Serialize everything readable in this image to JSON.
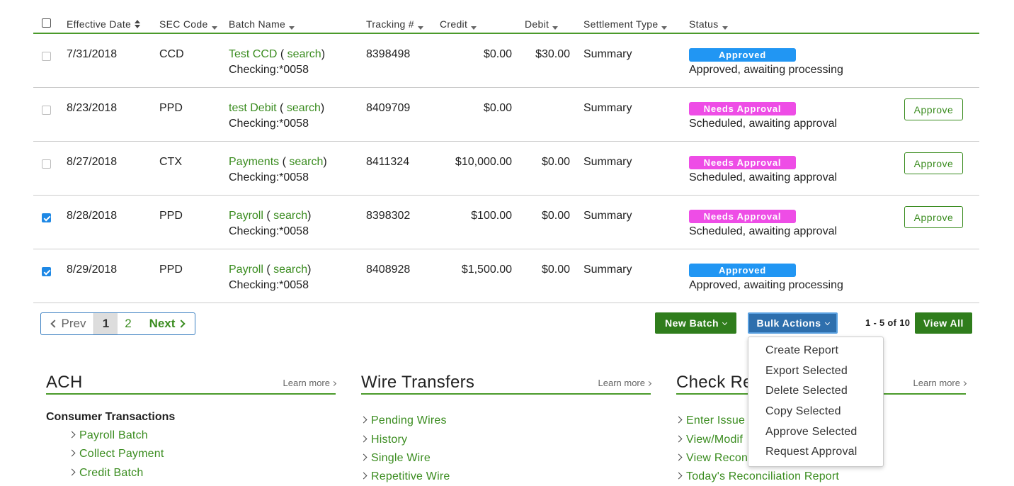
{
  "table": {
    "headers": {
      "effective_date": "Effective Date",
      "sec_code": "SEC Code",
      "batch_name": "Batch Name",
      "tracking": "Tracking #",
      "credit": "Credit",
      "debit": "Debit",
      "settlement_type": "Settlement Type",
      "status": "Status"
    },
    "rows": [
      {
        "checked": false,
        "date": "7/31/2018",
        "sec": "CCD",
        "name": "Test CCD",
        "search_open": " ( ",
        "search": "search",
        "search_close": ")",
        "account": "Checking:*0058",
        "tracking": "8398498",
        "credit": "$0.00",
        "debit": "$30.00",
        "settlement": "Summary",
        "badge": "Approved",
        "status": "Approved, awaiting processing",
        "action": ""
      },
      {
        "checked": false,
        "date": "8/23/2018",
        "sec": "PPD",
        "name": "test Debit",
        "search_open": " ( ",
        "search": "search",
        "search_close": ")",
        "account": "Checking:*0058",
        "tracking": "8409709",
        "credit": "$0.00",
        "debit": "",
        "settlement": "Summary",
        "badge": "Needs Approval",
        "status": "Scheduled, awaiting approval",
        "action": "Approve"
      },
      {
        "checked": false,
        "date": "8/27/2018",
        "sec": "CTX",
        "name": "Payments",
        "search_open": " ( ",
        "search": "search",
        "search_close": ")",
        "account": "Checking:*0058",
        "tracking": "8411324",
        "credit": "$10,000.00",
        "debit": "$0.00",
        "settlement": "Summary",
        "badge": "Needs Approval",
        "status": "Scheduled, awaiting approval",
        "action": "Approve"
      },
      {
        "checked": true,
        "date": "8/28/2018",
        "sec": "PPD",
        "name": "Payroll",
        "search_open": " ( ",
        "search": "search",
        "search_close": ")",
        "account": "Checking:*0058",
        "tracking": "8398302",
        "credit": "$100.00",
        "debit": "$0.00",
        "settlement": "Summary",
        "badge": "Needs Approval",
        "status": "Scheduled, awaiting approval",
        "action": "Approve"
      },
      {
        "checked": true,
        "date": "8/29/2018",
        "sec": "PPD",
        "name": "Payroll",
        "search_open": " ( ",
        "search": "search",
        "search_close": ")",
        "account": "Checking:*0058",
        "tracking": "8408928",
        "credit": "$1,500.00",
        "debit": "$0.00",
        "settlement": "Summary",
        "badge": "Approved",
        "status": "Approved, awaiting processing",
        "action": ""
      }
    ]
  },
  "pagination": {
    "prev": "Prev",
    "page1": "1",
    "page2": "2",
    "next": "Next"
  },
  "toolbar": {
    "new_batch": "New Batch",
    "bulk_actions": "Bulk Actions",
    "count": "1 - 5 of 10",
    "view_all": "View All"
  },
  "bulk_menu": [
    "Create Report",
    "Export Selected",
    "Delete Selected",
    "Copy Selected",
    "Approve Selected",
    "Request Approval"
  ],
  "sections": {
    "ach": {
      "title": "ACH",
      "learn_more": "Learn more",
      "subheading": "Consumer Transactions",
      "links": [
        "Payroll Batch",
        "Collect Payment",
        "Credit Batch"
      ]
    },
    "wire": {
      "title": "Wire Transfers",
      "learn_more": "Learn more",
      "links": [
        "Pending Wires",
        "History",
        "Single Wire",
        "Repetitive Wire"
      ]
    },
    "check": {
      "title": "Check Re",
      "learn_more": "Learn more",
      "links": [
        "Enter Issue",
        "View/Modif",
        "View Recon",
        "Today's Reconciliation Report"
      ]
    }
  },
  "colors": {
    "brand_green": "#3a8c1f",
    "approved_badge": "#2196f3",
    "needs_approval_badge": "#ee4de6",
    "bulk_blue": "#2e6fad"
  }
}
